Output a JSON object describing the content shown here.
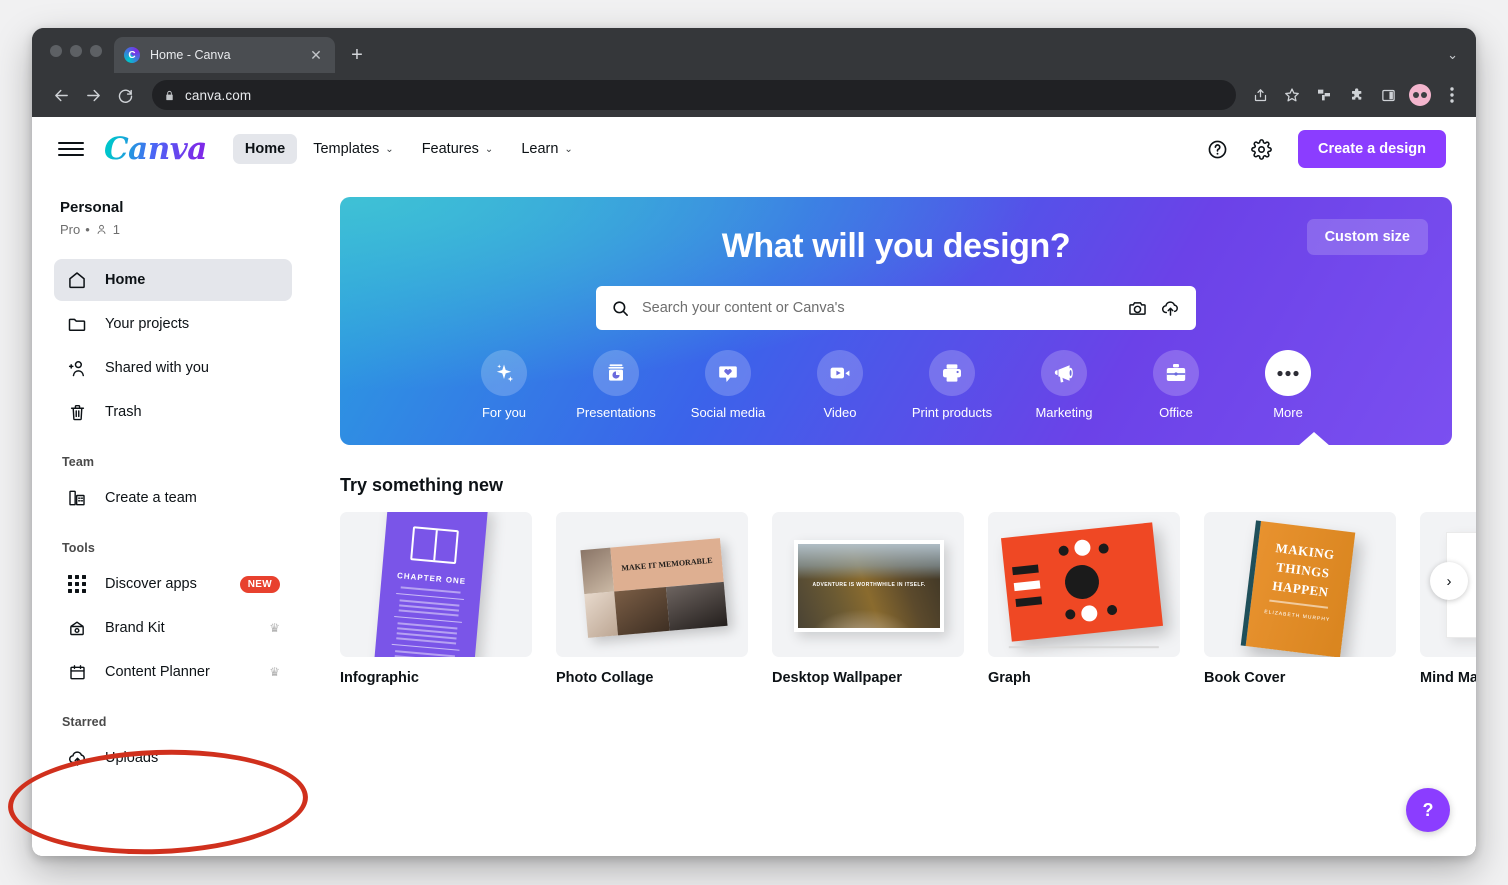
{
  "browser": {
    "tab_title": "Home - Canva",
    "tab_close_label": "✕",
    "new_tab_label": "+",
    "tabstrip_caret": "⌄",
    "url": "canva.com",
    "back_icon": "back-arrow-icon",
    "forward_icon": "forward-arrow-icon",
    "reload_icon": "reload-icon",
    "toolbar_icons": [
      "share-icon",
      "bookmark-star-icon",
      "tab-split-icon",
      "extensions-puzzle-icon",
      "side-panel-icon",
      "profile-avatar-icon",
      "browser-menu-icon"
    ]
  },
  "header": {
    "logo_text": "Canva",
    "nav": [
      {
        "label": "Home",
        "active": true,
        "has_caret": false
      },
      {
        "label": "Templates",
        "active": false,
        "has_caret": true
      },
      {
        "label": "Features",
        "active": false,
        "has_caret": true
      },
      {
        "label": "Learn",
        "active": false,
        "has_caret": true
      }
    ],
    "caret_glyph": "⌄",
    "help_icon": "help-circle-icon",
    "settings_icon": "gear-icon",
    "create_button": "Create a design",
    "accent_purple": "#8b3dff"
  },
  "sidebar": {
    "account_name": "Personal",
    "account_plan": "Pro",
    "account_separator": "•",
    "account_members": "1",
    "groups": [
      {
        "heading": "",
        "items": [
          {
            "label": "Home",
            "icon": "home-icon",
            "active": true
          },
          {
            "label": "Your projects",
            "icon": "folder-icon",
            "active": false
          },
          {
            "label": "Shared with you",
            "icon": "add-people-icon",
            "active": false
          },
          {
            "label": "Trash",
            "icon": "trash-icon",
            "active": false
          }
        ]
      },
      {
        "heading": "Team",
        "items": [
          {
            "label": "Create a team",
            "icon": "building-icon",
            "active": false
          }
        ]
      },
      {
        "heading": "Tools",
        "items": [
          {
            "label": "Discover apps",
            "icon": "apps-grid-icon",
            "active": false,
            "badge": "NEW"
          },
          {
            "label": "Brand Kit",
            "icon": "brand-kit-icon",
            "active": false,
            "crown": true
          },
          {
            "label": "Content Planner",
            "icon": "calendar-icon",
            "active": false,
            "crown": true
          }
        ]
      },
      {
        "heading": "Starred",
        "items": [
          {
            "label": "Uploads",
            "icon": "cloud-upload-icon",
            "active": false
          }
        ]
      }
    ],
    "crown_glyph": "♛"
  },
  "banner": {
    "title": "What will you design?",
    "custom_size_button": "Custom size",
    "search_placeholder": "Search your content or Canva's",
    "search_icon": "search-icon",
    "camera_icon": "camera-icon",
    "upload_icon": "cloud-upload-icon",
    "categories": [
      {
        "label": "For you",
        "icon": "sparkle-icon",
        "active": false
      },
      {
        "label": "Presentations",
        "icon": "presentation-icon",
        "active": false
      },
      {
        "label": "Social media",
        "icon": "heart-bubble-icon",
        "active": false
      },
      {
        "label": "Video",
        "icon": "video-camera-icon",
        "active": false
      },
      {
        "label": "Print products",
        "icon": "printer-icon",
        "active": false
      },
      {
        "label": "Marketing",
        "icon": "megaphone-icon",
        "active": false
      },
      {
        "label": "Office",
        "icon": "briefcase-icon",
        "active": false
      },
      {
        "label": "More",
        "icon": "ellipsis-icon",
        "active": true
      }
    ]
  },
  "section": {
    "title": "Try something new",
    "cards": [
      {
        "label": "Infographic",
        "art": "infographic",
        "art_text": "CHAPTER ONE"
      },
      {
        "label": "Photo Collage",
        "art": "collage",
        "art_text": "MAKE IT MEMORABLE"
      },
      {
        "label": "Desktop Wallpaper",
        "art": "wallpaper",
        "art_text": "ADVENTURE IS WORTHWHILE IN ITSELF."
      },
      {
        "label": "Graph",
        "art": "graph",
        "art_text": ""
      },
      {
        "label": "Book Cover",
        "art": "book",
        "art_text": "MAKING THINGS HAPPEN",
        "art_author": "ELIZABETH MURPHY"
      },
      {
        "label": "Mind Map",
        "art": "mindmap",
        "art_text": ""
      }
    ],
    "next_arrow": "›"
  },
  "help_fab": {
    "label": "?"
  },
  "annotation": {
    "shape": "red-ellipse",
    "color": "#d0301d",
    "target": "Starred / Uploads"
  }
}
